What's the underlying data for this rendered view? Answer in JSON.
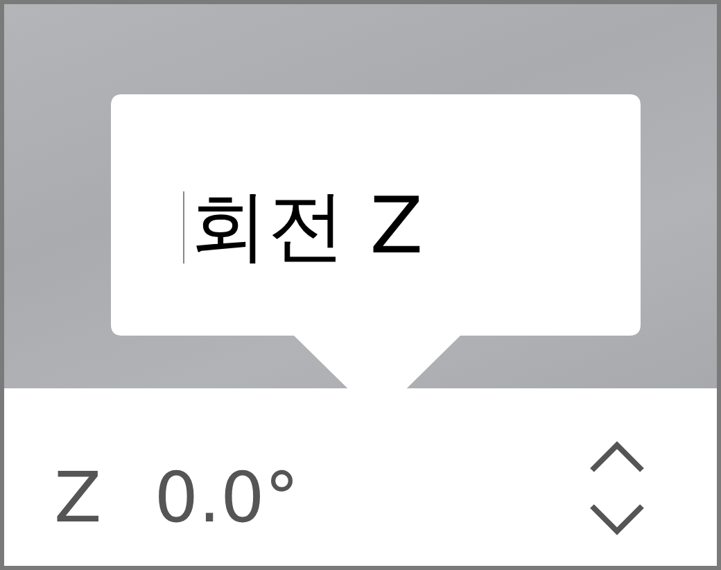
{
  "tooltip": {
    "text": "회전 Z",
    "text_cursor": true
  },
  "field": {
    "axis": "Z",
    "value": "0.0°"
  }
}
